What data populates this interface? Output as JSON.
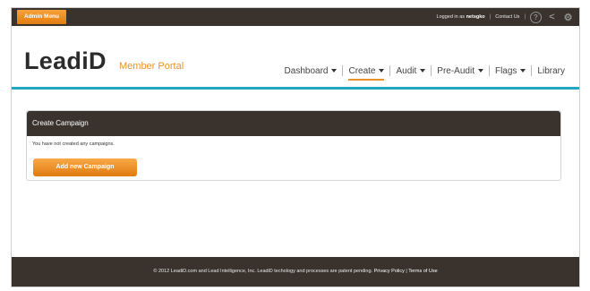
{
  "topbar": {
    "admin_menu": "Admin Menu",
    "logged_in_prefix": "Logged in as",
    "username": "netsgko",
    "contact_us": "Contact Us",
    "separator": "|",
    "help_glyph": "?",
    "share_glyph": "<",
    "settings_glyph": "⚙"
  },
  "header": {
    "logo": "LeadiD",
    "logo_sub": "Member Portal"
  },
  "nav": {
    "items": [
      {
        "label": "Dashboard"
      },
      {
        "label": "Create"
      },
      {
        "label": "Audit"
      },
      {
        "label": "Pre-Audit"
      },
      {
        "label": "Flags"
      },
      {
        "label": "Library"
      }
    ]
  },
  "panel": {
    "title": "Create Campaign",
    "message": "You have not created any campaigns.",
    "add_button": "Add new Campaign"
  },
  "footer": {
    "copyright": "© 2012 LeadiD.com and Lead Intelligence, Inc. LeadiD techology and processes are patent pending.",
    "privacy": "Privacy Policy",
    "separator": "|",
    "terms": "Terms of Use"
  },
  "colors": {
    "accent_orange": "#e8922b",
    "teal_line": "#24a7c1",
    "dark_bar": "#3a332d"
  }
}
